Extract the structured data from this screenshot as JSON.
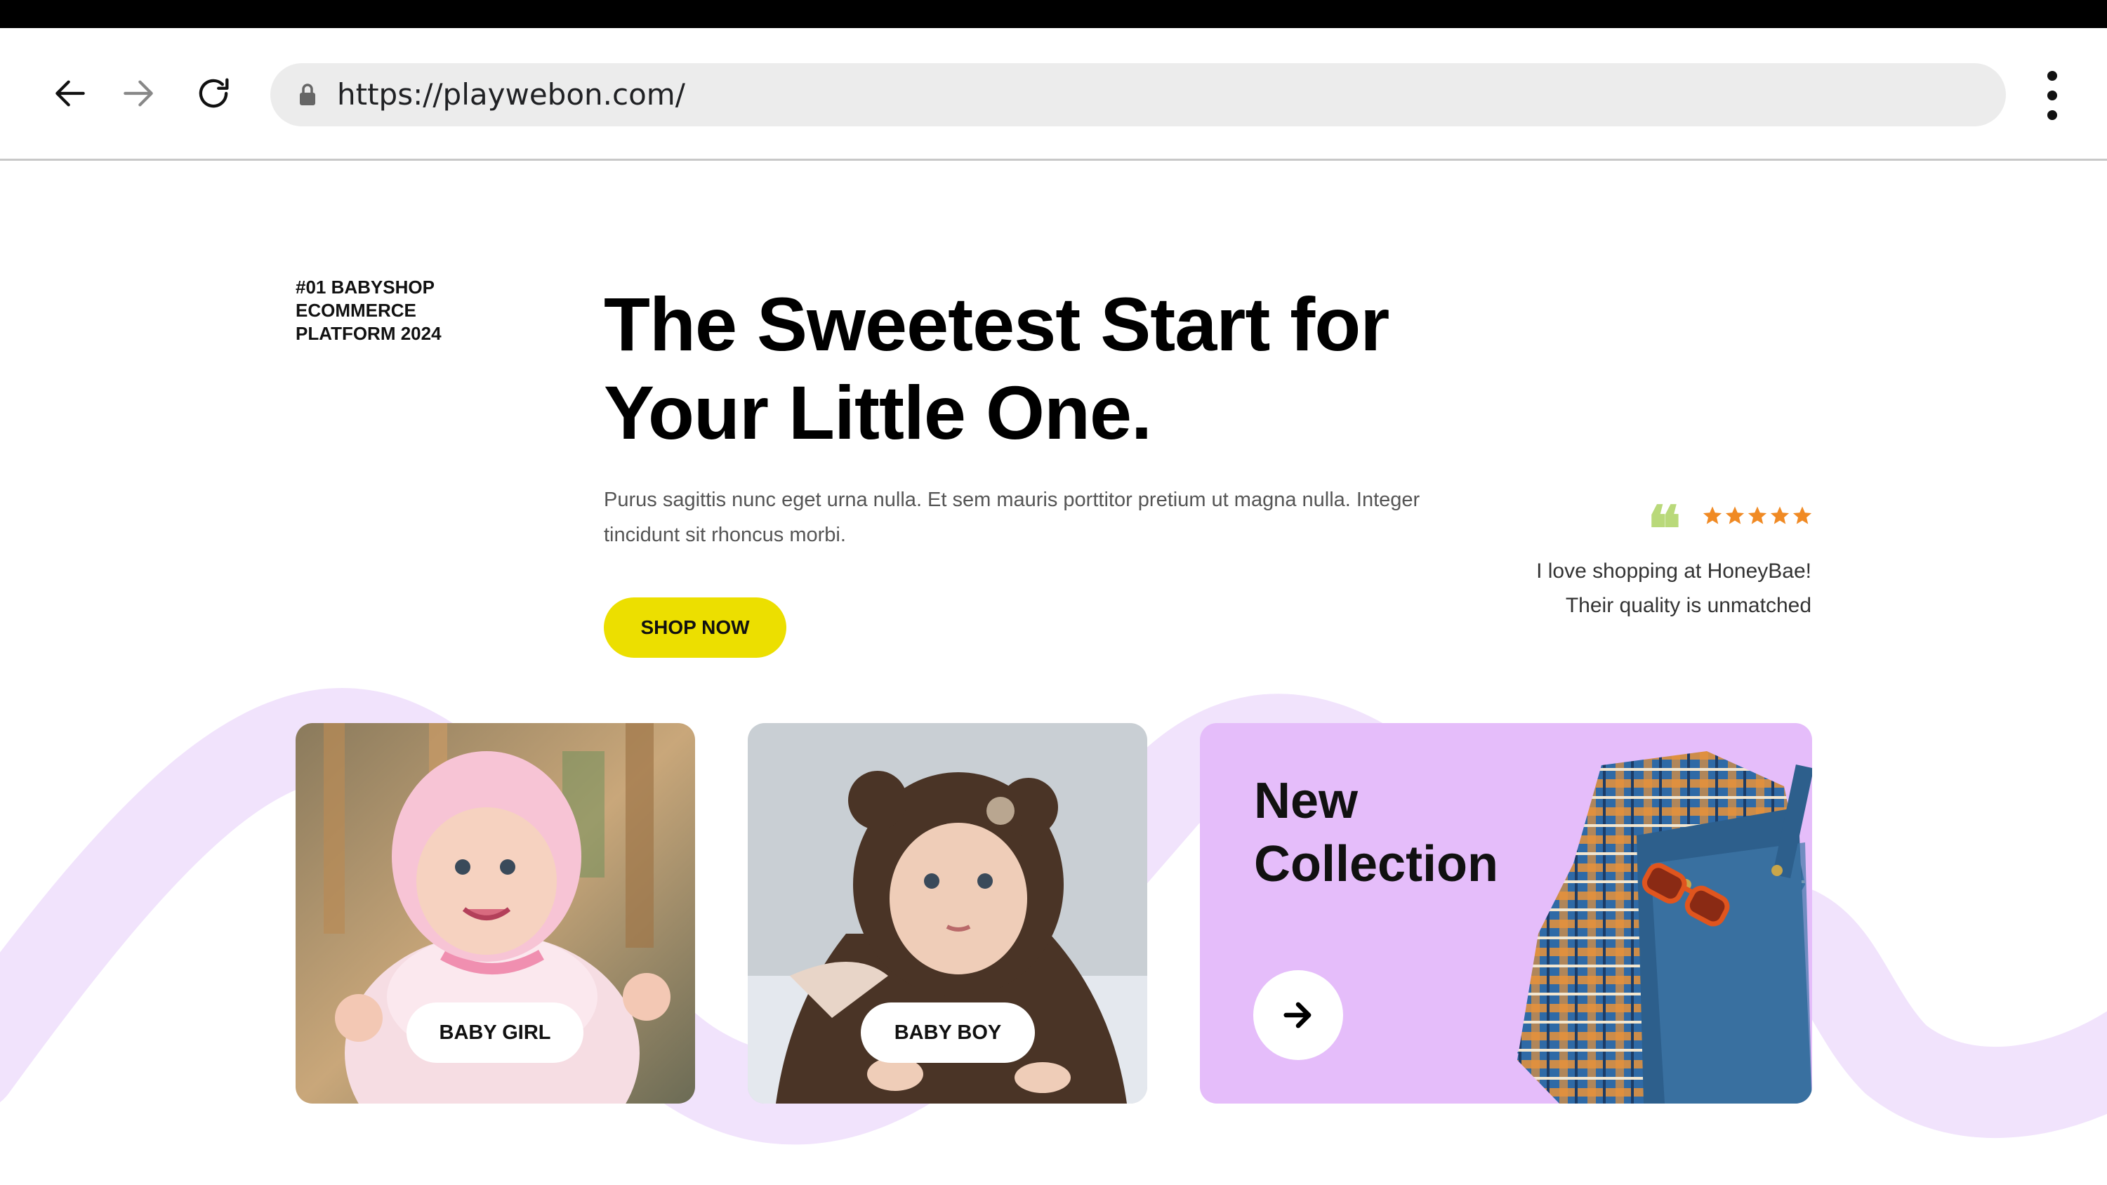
{
  "browser": {
    "url": "https://playwebon.com/",
    "icons": [
      "back-arrow-icon",
      "forward-arrow-icon",
      "reload-icon",
      "lock-icon",
      "more-vert-icon"
    ]
  },
  "hero": {
    "tagline": "#01 BABYSHOP\nECOMMERCE\nPLATFORM 2024",
    "headline": "The Sweetest Start for\nYour Little One.",
    "description": "Purus sagittis nunc eget urna nulla. Et sem mauris porttitor pretium ut magna nulla. Integer tincidunt sit rhoncus morbi.",
    "cta_label": "SHOP NOW"
  },
  "testimonial": {
    "rating": 5,
    "text": "I love shopping at HoneyBae! Their quality is unmatched"
  },
  "cards": {
    "girl_label": "BABY GIRL",
    "boy_label": "BABY BOY",
    "new_collection_title": "New\nCollection"
  },
  "colors": {
    "accent_yellow": "#ecdf00",
    "lavender": "#e5bdfa",
    "wave": "#f1e3fc",
    "star_orange": "#f08a24",
    "quote_green": "#b9d97a"
  }
}
